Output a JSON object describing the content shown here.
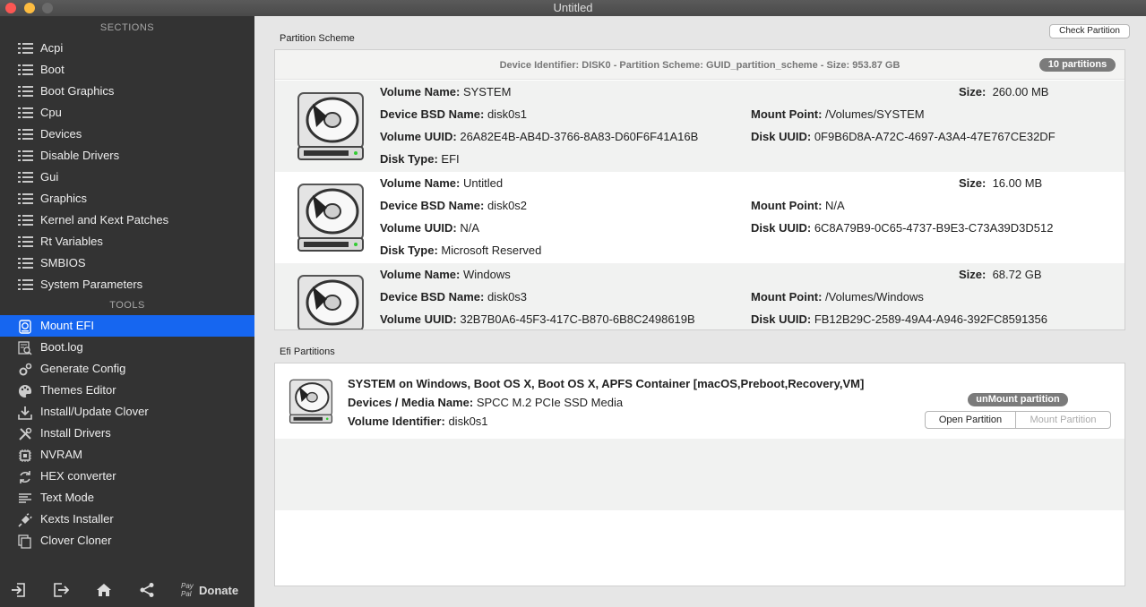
{
  "window": {
    "title": "Untitled"
  },
  "sidebar": {
    "sections_label": "SECTIONS",
    "tools_label": "TOOLS",
    "sections": [
      {
        "label": "Acpi",
        "icon": "list-icon"
      },
      {
        "label": "Boot",
        "icon": "list-icon"
      },
      {
        "label": "Boot Graphics",
        "icon": "list-icon"
      },
      {
        "label": "Cpu",
        "icon": "list-icon"
      },
      {
        "label": "Devices",
        "icon": "list-icon"
      },
      {
        "label": "Disable Drivers",
        "icon": "list-icon"
      },
      {
        "label": "Gui",
        "icon": "list-icon"
      },
      {
        "label": "Graphics",
        "icon": "list-icon"
      },
      {
        "label": "Kernel and Kext Patches",
        "icon": "list-icon"
      },
      {
        "label": "Rt Variables",
        "icon": "list-icon"
      },
      {
        "label": "SMBIOS",
        "icon": "list-icon"
      },
      {
        "label": "System Parameters",
        "icon": "list-icon"
      }
    ],
    "tools": [
      {
        "label": "Mount EFI",
        "icon": "disk-icon",
        "selected": true
      },
      {
        "label": "Boot.log",
        "icon": "log-search-icon"
      },
      {
        "label": "Generate Config",
        "icon": "gear-icon"
      },
      {
        "label": "Themes Editor",
        "icon": "palette-icon"
      },
      {
        "label": "Install/Update Clover",
        "icon": "download-icon"
      },
      {
        "label": "Install Drivers",
        "icon": "tools-icon"
      },
      {
        "label": "NVRAM",
        "icon": "chip-icon"
      },
      {
        "label": "HEX converter",
        "icon": "refresh-icon"
      },
      {
        "label": "Text Mode",
        "icon": "text-icon"
      },
      {
        "label": "Kexts Installer",
        "icon": "plug-icon"
      },
      {
        "label": "Clover Cloner",
        "icon": "copy-icon"
      }
    ],
    "bottom": {
      "donate_paypal_top": "Pay",
      "donate_paypal_bottom": "Pal",
      "donate_label": "Donate"
    }
  },
  "partition_scheme": {
    "group_title": "Partition Scheme",
    "check_button": "Check Partition",
    "header": "Device Identifier: DISK0 - Partition Scheme: GUID_partition_scheme - Size: 953.87 GB",
    "badge": "10 partitions",
    "labels": {
      "volume_name": "Volume Name:",
      "bsd_name": "Device BSD Name:",
      "volume_uuid": "Volume UUID:",
      "disk_type": "Disk Type:",
      "size": "Size:",
      "mount_point": "Mount Point:",
      "disk_uuid": "Disk UUID:"
    },
    "partitions": [
      {
        "volume_name": "SYSTEM",
        "bsd_name": "disk0s1",
        "volume_uuid": "26A82E4B-AB4D-3766-8A83-D60F6F41A16B",
        "disk_type": "EFI",
        "size": "260.00 MB",
        "mount_point": "/Volumes/SYSTEM",
        "disk_uuid": "0F9B6D8A-A72C-4697-A3A4-47E767CE32DF"
      },
      {
        "volume_name": "Untitled",
        "bsd_name": "disk0s2",
        "volume_uuid": "N/A",
        "disk_type": "Microsoft Reserved",
        "size": "16.00 MB",
        "mount_point": "N/A",
        "disk_uuid": "6C8A79B9-0C65-4737-B9E3-C73A39D3D512"
      },
      {
        "volume_name": "Windows",
        "bsd_name": "disk0s3",
        "volume_uuid": "32B7B0A6-45F3-417C-B870-6B8C2498619B",
        "size": "68.72 GB",
        "mount_point": "/Volumes/Windows",
        "disk_uuid": "FB12B29C-2589-49A4-A946-392FC8591356"
      }
    ]
  },
  "efi_partitions": {
    "group_title": "Efi Partitions",
    "item": {
      "title": "SYSTEM on Windows, Boot OS X, Boot OS X, APFS Container [macOS,Preboot,Recovery,VM]",
      "media_label": "Devices / Media Name:",
      "media_value": "SPCC M.2 PCIe SSD Media",
      "volume_id_label": "Volume Identifier:",
      "volume_id_value": "disk0s1",
      "status_badge": "unMount partition",
      "open_button": "Open Partition",
      "mount_button": "Mount Partition"
    }
  },
  "colors": {
    "accent": "#1666f0",
    "sidebar_bg": "#333333",
    "badge": "#7b7b7b"
  }
}
